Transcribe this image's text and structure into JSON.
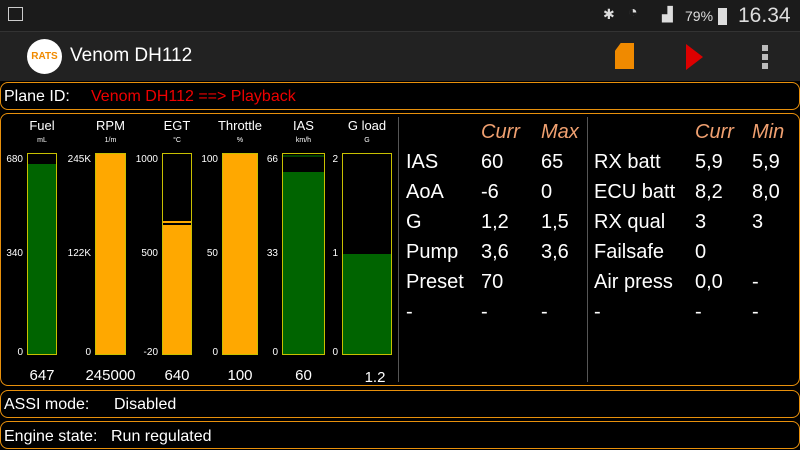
{
  "status_bar": {
    "battery": "79%",
    "time": "16.34"
  },
  "app_bar": {
    "logo": "RATS",
    "title": "Venom DH112"
  },
  "plane": {
    "label": "Plane ID:",
    "value": "Venom DH112 ==> Playback"
  },
  "gauges": [
    {
      "title": "Fuel",
      "unit": "mL",
      "scale": [
        "680",
        "340",
        "0"
      ],
      "min": 0,
      "max": 680,
      "value": 647,
      "display": "647",
      "peak": 680,
      "color": "#006400"
    },
    {
      "title": "RPM",
      "unit": "1/m",
      "scale": [
        "245K",
        "122K",
        "0"
      ],
      "min": 0,
      "max": 245000,
      "value": 245000,
      "display": "245000",
      "color": "#ffa800"
    },
    {
      "title": "EGT",
      "unit": "°C",
      "scale": [
        "1000",
        "500",
        "-20"
      ],
      "min": -20,
      "max": 1000,
      "value": 640,
      "display": "640",
      "peak": 650,
      "color": "#ffa800"
    },
    {
      "title": "Throttle",
      "unit": "%",
      "scale": [
        "100",
        "50",
        "0"
      ],
      "min": 0,
      "max": 100,
      "value": 100,
      "display": "100",
      "color": "#ffa800"
    },
    {
      "title": "IAS",
      "unit": "km/h",
      "scale": [
        "66",
        "33",
        "0"
      ],
      "min": 0,
      "max": 66,
      "value": 60,
      "display": "60",
      "peak": 65,
      "color": "#006400"
    },
    {
      "title": "G load",
      "unit": "G",
      "scale": [
        "2",
        "1",
        "0"
      ],
      "min": 0,
      "max": 2,
      "value": 1.0,
      "display": "1.2",
      "color": "#006400"
    }
  ],
  "table_left": {
    "headers": [
      "Curr",
      "Max"
    ],
    "rows": [
      [
        "IAS",
        "60",
        "65"
      ],
      [
        "AoA",
        "-6",
        "0"
      ],
      [
        "G",
        "1,2",
        "1,5"
      ],
      [
        "Pump",
        "3,6",
        "3,6"
      ],
      [
        "Preset",
        "70",
        ""
      ],
      [
        "-",
        "-",
        "-"
      ]
    ]
  },
  "table_right": {
    "headers": [
      "Curr",
      "Min"
    ],
    "rows": [
      [
        "RX batt",
        "5,9",
        "5,9"
      ],
      [
        "ECU batt",
        "8,2",
        "8,0"
      ],
      [
        "RX qual",
        "3",
        "3"
      ],
      [
        "Failsafe",
        "0",
        ""
      ],
      [
        "Air press",
        "0,0",
        "-"
      ],
      [
        "-",
        "-",
        "-"
      ]
    ]
  },
  "assi": {
    "label": "ASSI mode:",
    "value": "Disabled"
  },
  "engine": {
    "label": "Engine state:",
    "value": "Run regulated"
  }
}
